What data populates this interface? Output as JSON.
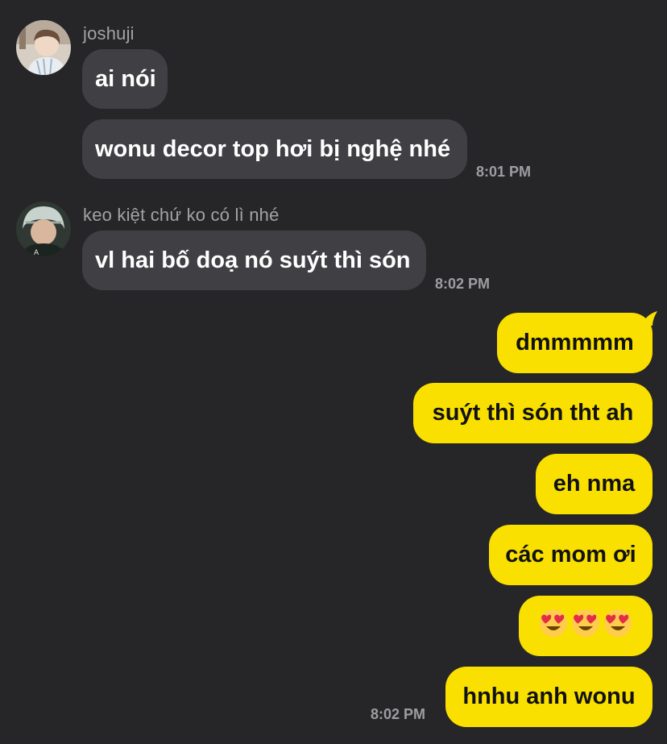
{
  "messages": [
    {
      "sender": "joshuji",
      "text": "ai nói"
    },
    {
      "sender": "joshuji",
      "text": "wonu decor top hơi bị nghệ nhé",
      "time": "8:01 PM"
    },
    {
      "sender": "keo kiệt chứ ko có lì nhé",
      "text": "vl hai bố doạ nó suýt thì són",
      "time": "8:02 PM"
    }
  ],
  "sent": [
    {
      "text": "dmmmmm"
    },
    {
      "text": "suýt thì són tht ah"
    },
    {
      "text": "eh nma"
    },
    {
      "text": "các mom ơi"
    },
    {
      "icons": [
        "heart-eyes-emoji",
        "heart-eyes-emoji",
        "heart-eyes-emoji"
      ]
    },
    {
      "text": "hnhu anh wonu",
      "time": "8:02 PM"
    }
  ],
  "colors": {
    "background": "#262628",
    "incoming_bubble": "#404044",
    "outgoing_bubble": "#f9e000"
  }
}
